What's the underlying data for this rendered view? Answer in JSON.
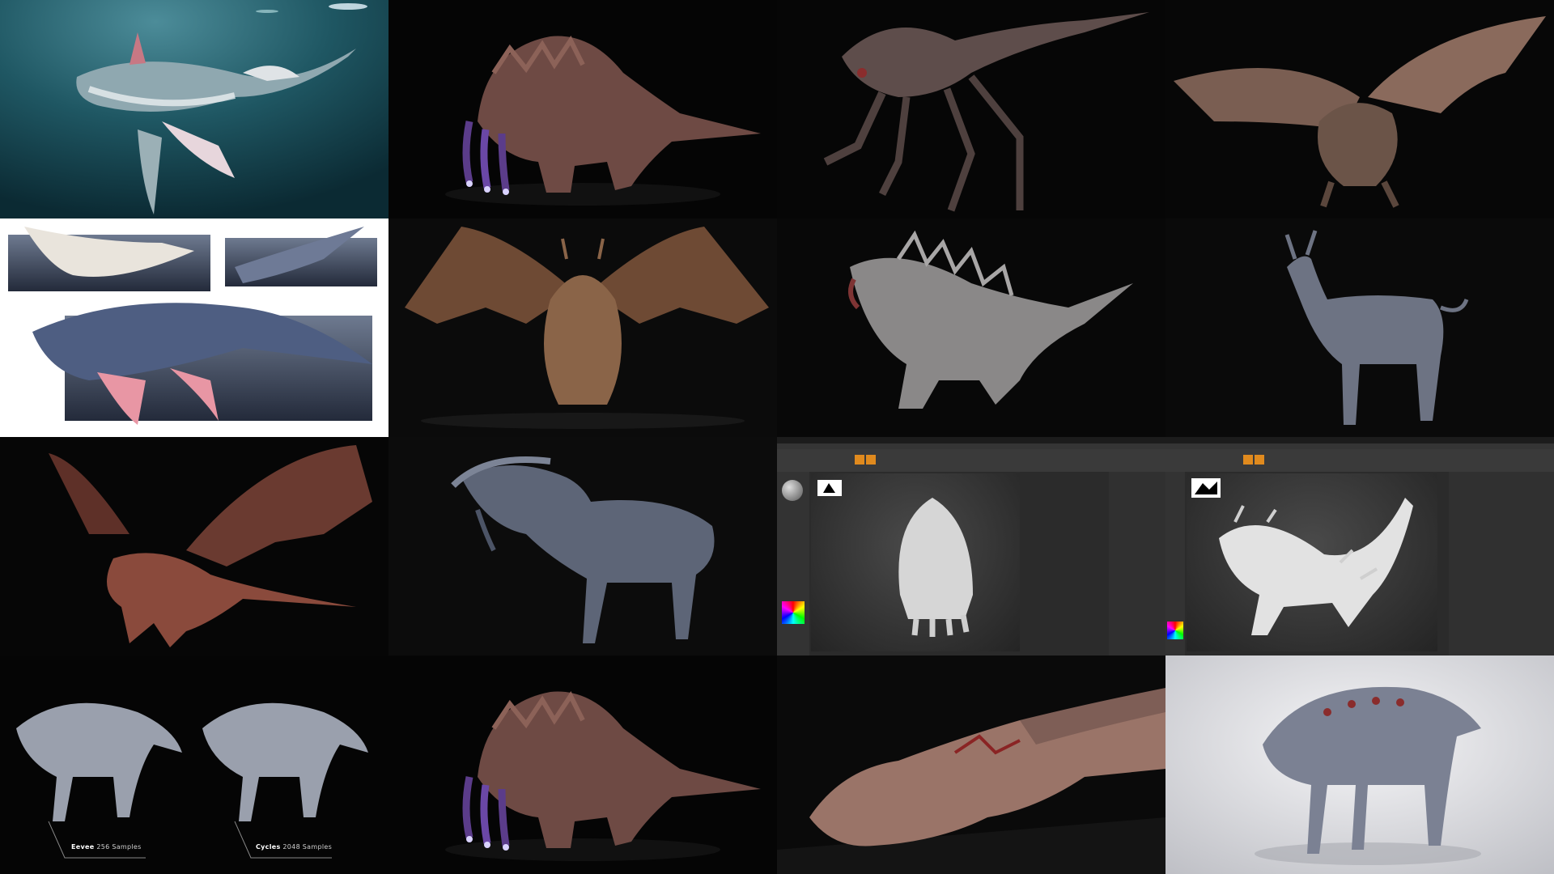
{
  "collage": {
    "tiles": [
      {
        "subject": "sea-creature-underwater",
        "bg": "#1d4a55"
      },
      {
        "subject": "horned-beast-glowing-tentacles",
        "bg": "#050505"
      },
      {
        "subject": "spindly-long-tail-creature",
        "bg": "#060606"
      },
      {
        "subject": "winged-dragon-front",
        "bg": "#070707"
      },
      {
        "subject": "sea-creature-turnaround",
        "bg": "#ffffff"
      },
      {
        "subject": "winged-dragon-spread",
        "bg": "#0b0b0b"
      },
      {
        "subject": "spiked-reptile-beast",
        "bg": "#080808"
      },
      {
        "subject": "horned-horse-creature",
        "bg": "#0a0a0a"
      },
      {
        "subject": "red-winged-dragon",
        "bg": "#060606"
      },
      {
        "subject": "alien-horse-creature",
        "bg": "#0c0c0c"
      },
      {
        "subject": "zbrush-sculpt-armored-beast",
        "bg": "#2b2b2b"
      },
      {
        "subject": "zbrush-sculpt-spiked-beast",
        "bg": "#2b2b2b"
      },
      {
        "subject": "render-comparison-beasts",
        "bg": "#050505"
      },
      {
        "subject": "horned-beast-glowing-tentacles",
        "bg": "#050505"
      },
      {
        "subject": "lying-dragon",
        "bg": "#0a0a0a"
      },
      {
        "subject": "grey-beast-studio",
        "bg": "#e8e8ea"
      }
    ],
    "render_labels": {
      "eevee_engine": "Eevee",
      "eevee_samples": "256 Samples",
      "cycles_engine": "Cycles",
      "cycles_samples": "2048 Samples"
    }
  },
  "colors": {
    "accent_orange": "#e08a1e",
    "glow_purple": "#7a5cff"
  }
}
